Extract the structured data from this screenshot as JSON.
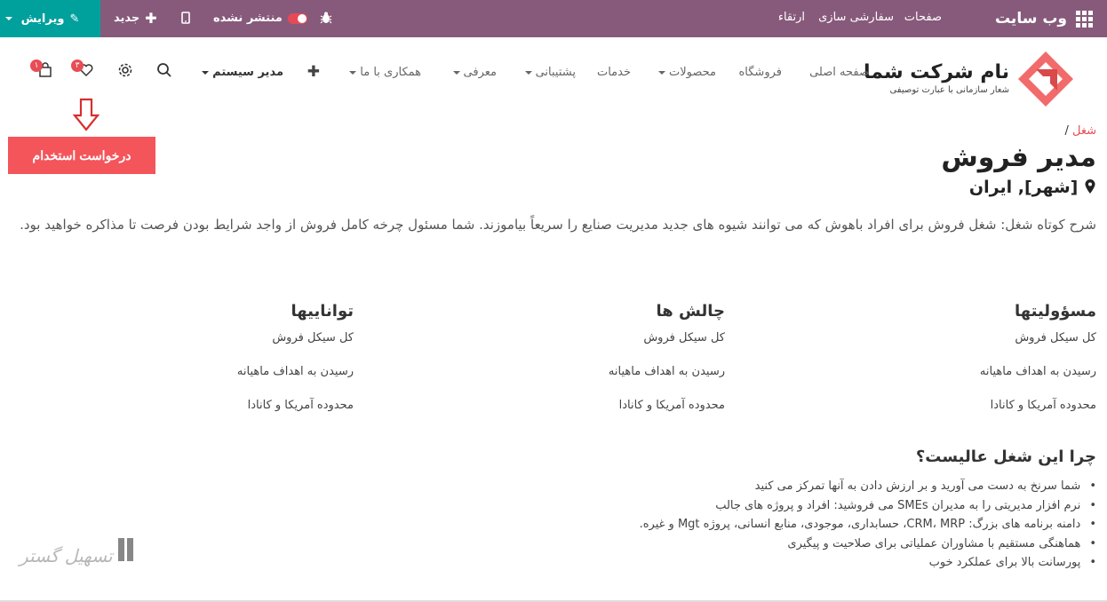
{
  "topbar": {
    "brand": "وب سایت",
    "menu": [
      "صفحات",
      "سفارشی سازی",
      "ارتقاء"
    ],
    "unpublished": "منتشر نشده",
    "new_label": "جدید",
    "edit_label": "ویرایش"
  },
  "header": {
    "logo_name": "نام شرکت شما",
    "logo_tagline": "شعار سازمانی با عبارت توصیفی",
    "nav": {
      "home": "صفحه اصلی",
      "shop": "فروشگاه",
      "products": "محصولات",
      "services": "خدمات",
      "support": "پشتیبانی",
      "intro": "معرفی",
      "cooperation": "همکاری با ما",
      "admin": "مدیر سیستم"
    },
    "wishlist_count": "۳",
    "cart_count": "۱"
  },
  "apply_button": "درخواست استخدام",
  "breadcrumb": {
    "link": "شغل",
    "separator": "/"
  },
  "job": {
    "title": "مدیر فروش",
    "location": "[شهر], ایران",
    "description": "شرح کوتاه شغل: شغل فروش برای افراد باهوش که می توانند شیوه های جدید مدیریت صنایع را سریعاً بیاموزند. شما مسئول چرخه کامل فروش از واجد شرایط بودن فرصت تا مذاکره خواهید بود."
  },
  "columns": [
    {
      "title": "مسؤولیتها",
      "items": [
        "کل سیکل فروش",
        "رسیدن به اهداف ماهیانه",
        "محدوده آمریکا و کانادا"
      ]
    },
    {
      "title": "چالش ها",
      "items": [
        "کل سیکل فروش",
        "رسیدن به اهداف ماهیانه",
        "محدوده آمریکا و کانادا"
      ]
    },
    {
      "title": "تواناییها",
      "items": [
        "کل سیکل فروش",
        "رسیدن به اهداف ماهیانه",
        "محدوده آمریکا و کانادا"
      ]
    }
  ],
  "why": {
    "title": "چرا این شغل عالیست؟",
    "items": [
      "شما سرنخ به دست می آورید و بر ارزش دادن به آنها تمرکز می کنید",
      "نرم افزار مدیریتی را به مدیران SMEs می فروشید: افراد و پروژه های جالب",
      "دامنه برنامه های بزرگ: CRM، MRP، حسابداری، موجودی، منابع انسانی، پروژه Mgt و غیره.",
      "هماهنگی مستقیم با مشاوران عملیاتی برای صلاحیت و پیگیری",
      "پورسانت بالا برای عملکرد خوب"
    ]
  },
  "watermark": "تسهیل گستر",
  "colors": {
    "topbar": "#875a7b",
    "edit": "#00a09d",
    "accent": "#f4555a",
    "link": "#e84c55"
  },
  "icons": [
    "apps-grid-icon",
    "bug-icon",
    "toggle-icon",
    "mobile-icon",
    "plus-icon",
    "pencil-icon",
    "search-icon",
    "gear-icon",
    "heart-icon",
    "cart-icon",
    "map-marker-icon",
    "arrow-down-icon"
  ]
}
